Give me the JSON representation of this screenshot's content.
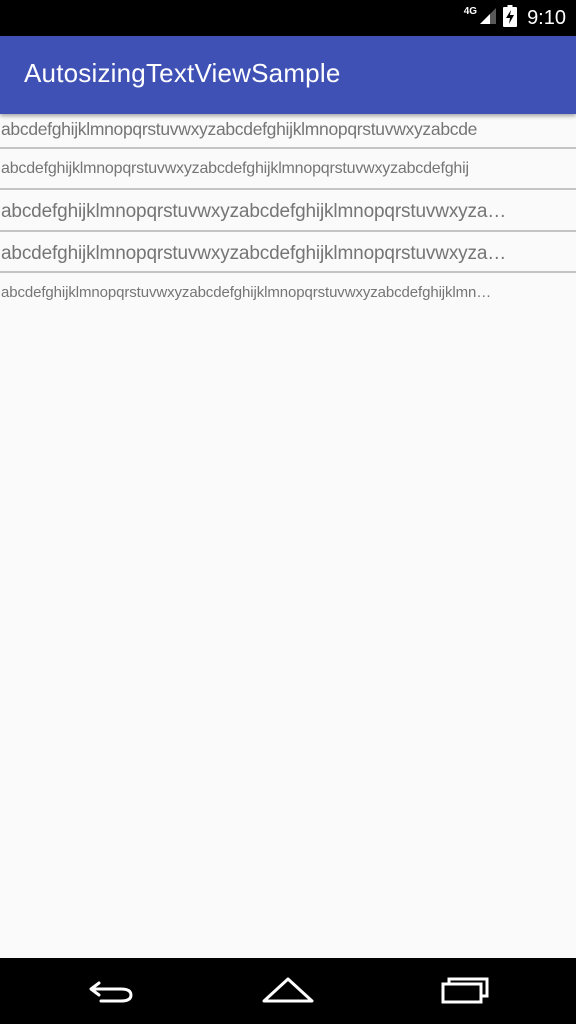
{
  "status_bar": {
    "network_type": "4G",
    "time": "9:10",
    "icons": [
      "signal-icon",
      "battery-charging-icon"
    ]
  },
  "app_bar": {
    "title": "AutosizingTextViewSample",
    "color": "#3f51b5"
  },
  "text_rows": [
    "abcdefghijklmnopqrstuvwxyzabcdefghijklmnopqrstuvwxyzabcde",
    "abcdefghijklmnopqrstuvwxyzabcdefghijklmnopqrstuvwxyzabcdefghij",
    "abcdefghijklmnopqrstuvwxyzabcdefghijklmnopqrstuvwxyza…",
    "abcdefghijklmnopqrstuvwxyzabcdefghijklmnopqrstuvwxyza…",
    "abcdefghijklmnopqrstuvwxyzabcdefghijklmnopqrstuvwxyzabcdefghijklmn…"
  ],
  "nav_bar": {
    "icons": [
      "back-icon",
      "home-icon",
      "recents-icon"
    ]
  }
}
